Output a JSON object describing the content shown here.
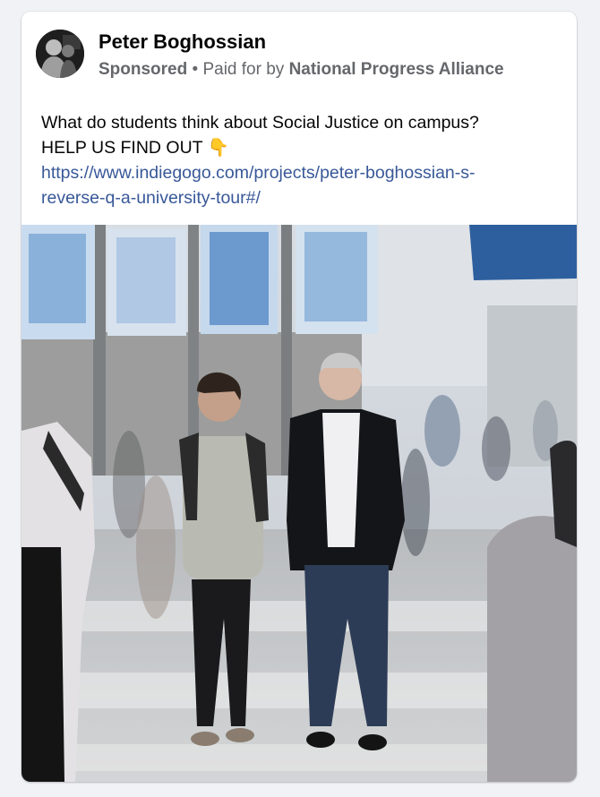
{
  "post": {
    "author": "Peter Boghossian",
    "sponsored_label": "Sponsored",
    "separator": " • ",
    "paid_for_prefix": "Paid for by ",
    "sponsor": "National Progress Alliance",
    "text_line1": "What do students think about Social Justice on campus?",
    "text_line2": "HELP US FIND OUT",
    "emoji": "👇",
    "link_line1": "https://www.indiegogo.com/projects/peter-boghossian-s-",
    "link_line2": "reverse-q-a-university-tour#/"
  },
  "colors": {
    "text_primary": "#050505",
    "text_secondary": "#65676b",
    "link": "#385898",
    "card_background": "#ffffff"
  },
  "icons": {
    "pointing_down": "backhand-index-pointing-down"
  }
}
